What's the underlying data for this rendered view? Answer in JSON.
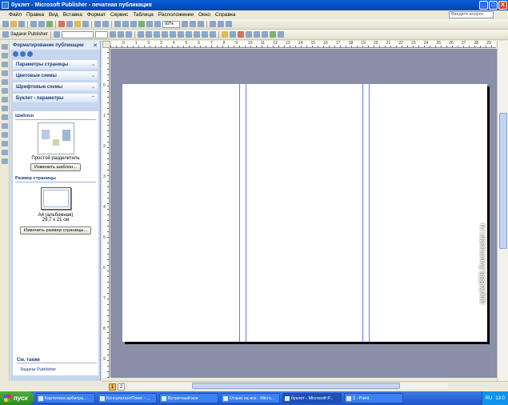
{
  "window": {
    "title": "буклет - Microsoft Publisher - печатная публикация",
    "minimize": "_",
    "maximize": "□",
    "close": "X"
  },
  "menu": [
    "Файл",
    "Правка",
    "Вид",
    "Вставка",
    "Формат",
    "Сервис",
    "Таблица",
    "Расположение",
    "Окно",
    "Справка"
  ],
  "help_placeholder": "Введите вопрос",
  "toolbar": {
    "zoom": "92%",
    "tasks_label": "Задачи Publisher"
  },
  "task_pane": {
    "title": "Форматирование публикации",
    "sections": [
      {
        "label": "Параметры страницы"
      },
      {
        "label": "Цветовые схемы"
      },
      {
        "label": "Шрифтовые схемы"
      },
      {
        "label": "Буклет - параметры"
      }
    ],
    "template_heading": "Шаблон",
    "template_name": "Простой разделитель",
    "change_template": "Изменить шаблон...",
    "page_size_heading": "Размер страницы",
    "page_size_name": "A4 (альбомная)",
    "page_size_dims": "29,7 x 21 см",
    "change_page_size": "Изменить размер страницы...",
    "see_also": "См. также",
    "see_also_link": "Задачи Publisher"
  },
  "rulers": {
    "h_ticks": [
      "0",
      "1",
      "2",
      "3",
      "4",
      "5",
      "6",
      "7",
      "8",
      "9",
      "10",
      "11",
      "12",
      "13",
      "14",
      "15",
      "16",
      "17",
      "18",
      "19",
      "20",
      "21",
      "22",
      "23",
      "24",
      "25",
      "26",
      "27",
      "28",
      "29"
    ],
    "v_ticks": [
      "0",
      "1",
      "2",
      "3",
      "4",
      "5",
      "6",
      "7",
      "8",
      "9"
    ]
  },
  "pages": [
    "1",
    "2"
  ],
  "taskbar": {
    "start": "пуск",
    "tasks": [
      {
        "label": "Картотека арбитра..."
      },
      {
        "label": "КонсультантПлюс - ..."
      },
      {
        "label": "Встречный иск"
      },
      {
        "label": "Отзыв на иск - Micro..."
      },
      {
        "label": "буклет - Microsoft P..."
      },
      {
        "label": "3 - Paint"
      }
    ],
    "lang": "RU",
    "clock": "13:0"
  },
  "watermark": "apple886.livemaster.ru"
}
